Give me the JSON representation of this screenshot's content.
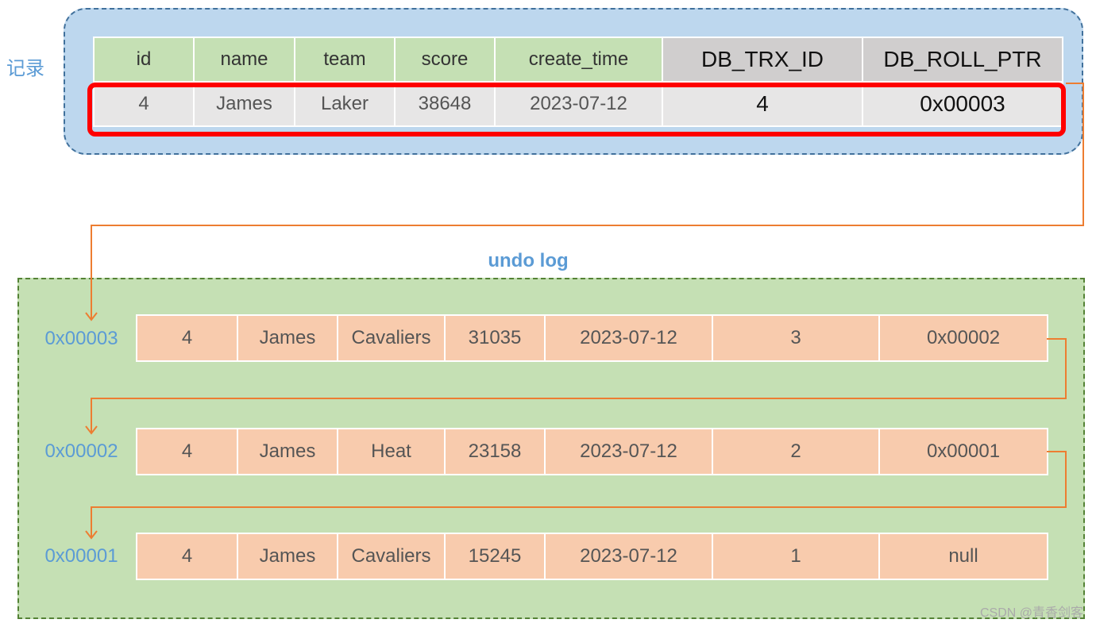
{
  "record": {
    "label": "记录",
    "columns": [
      "id",
      "name",
      "team",
      "score",
      "create_time",
      "DB_TRX_ID",
      "DB_ROLL_PTR"
    ],
    "row": [
      "4",
      "James",
      "Laker",
      "38648",
      "2023-07-12",
      "4",
      "0x00003"
    ]
  },
  "undo_log": {
    "title": "undo log",
    "entries": [
      {
        "address": "0x00003",
        "cells": [
          "4",
          "James",
          "Cavaliers",
          "31035",
          "2023-07-12",
          "3",
          "0x00002"
        ]
      },
      {
        "address": "0x00002",
        "cells": [
          "4",
          "James",
          "Heat",
          "23158",
          "2023-07-12",
          "2",
          "0x00001"
        ]
      },
      {
        "address": "0x00001",
        "cells": [
          "4",
          "James",
          "Cavaliers",
          "15245",
          "2023-07-12",
          "1",
          "null"
        ]
      }
    ]
  },
  "colors": {
    "record_bg": "#bdd7ee",
    "undo_bg": "#c5e0b4",
    "undo_cell": "#f8cbad",
    "highlight": "#ff0000",
    "arrow": "#ed7d31",
    "label_blue": "#5b9bd5"
  },
  "watermark": "CSDN @青香剑客"
}
